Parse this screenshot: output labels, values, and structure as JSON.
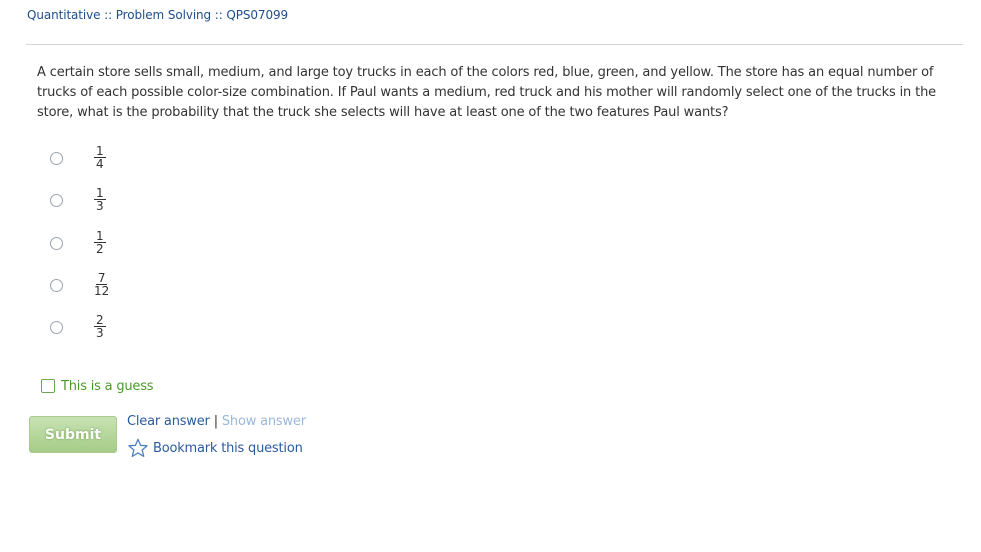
{
  "breadcrumb": {
    "text": "Quantitative :: Problem Solving :: QPS07099"
  },
  "question": {
    "text": "A certain store sells small, medium, and large toy trucks in each of the colors red, blue, green, and yellow. The store has an equal number of trucks of each possible color-size combination. If Paul wants a medium, red truck and his mother will randomly select one of the trucks in the store, what is the probability that the truck she selects will have at least one of the two features Paul wants?"
  },
  "choices": [
    {
      "numerator": "1",
      "denominator": "4"
    },
    {
      "numerator": "1",
      "denominator": "3"
    },
    {
      "numerator": "1",
      "denominator": "2"
    },
    {
      "numerator": "7",
      "denominator": "12"
    },
    {
      "numerator": "2",
      "denominator": "3"
    }
  ],
  "guess": {
    "label": "This is a guess",
    "checked": false
  },
  "actions": {
    "submit_label": "Submit",
    "clear_label": "Clear answer",
    "separator": "|",
    "show_label": "Show answer",
    "bookmark_label": "Bookmark this question"
  },
  "colors": {
    "link": "#2a5aa0",
    "disabled_link": "#9ab7d8",
    "guess_green": "#4a9a2b",
    "submit_green": "#a6cc88"
  },
  "icons": {
    "radio": "radio-circle-icon",
    "checkbox": "checkbox-icon",
    "bookmark": "star-outline-icon"
  }
}
